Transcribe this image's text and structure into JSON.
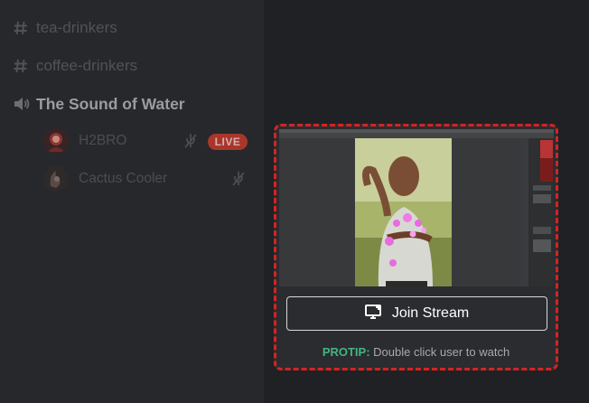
{
  "channels": [
    {
      "name": "tea-drinkers",
      "icon": "hash-icon"
    },
    {
      "name": "coffee-drinkers",
      "icon": "hash-icon"
    }
  ],
  "voice_channel": {
    "name": "The Sound of Water",
    "icon": "speaker-icon"
  },
  "voice_users": [
    {
      "name": "H2BRO",
      "live_badge": "LIVE",
      "avatar_color": "#7a2a2a"
    },
    {
      "name": "Cactus Cooler",
      "avatar_color": "#5a4a46"
    }
  ],
  "stream_popout": {
    "join_button_label": "Join Stream",
    "protip_tag": "PROTIP:",
    "protip_text": " Double click user to watch"
  },
  "colors": {
    "live": "#c0392b",
    "protip": "#43b581",
    "highlight_border": "#d42424"
  }
}
